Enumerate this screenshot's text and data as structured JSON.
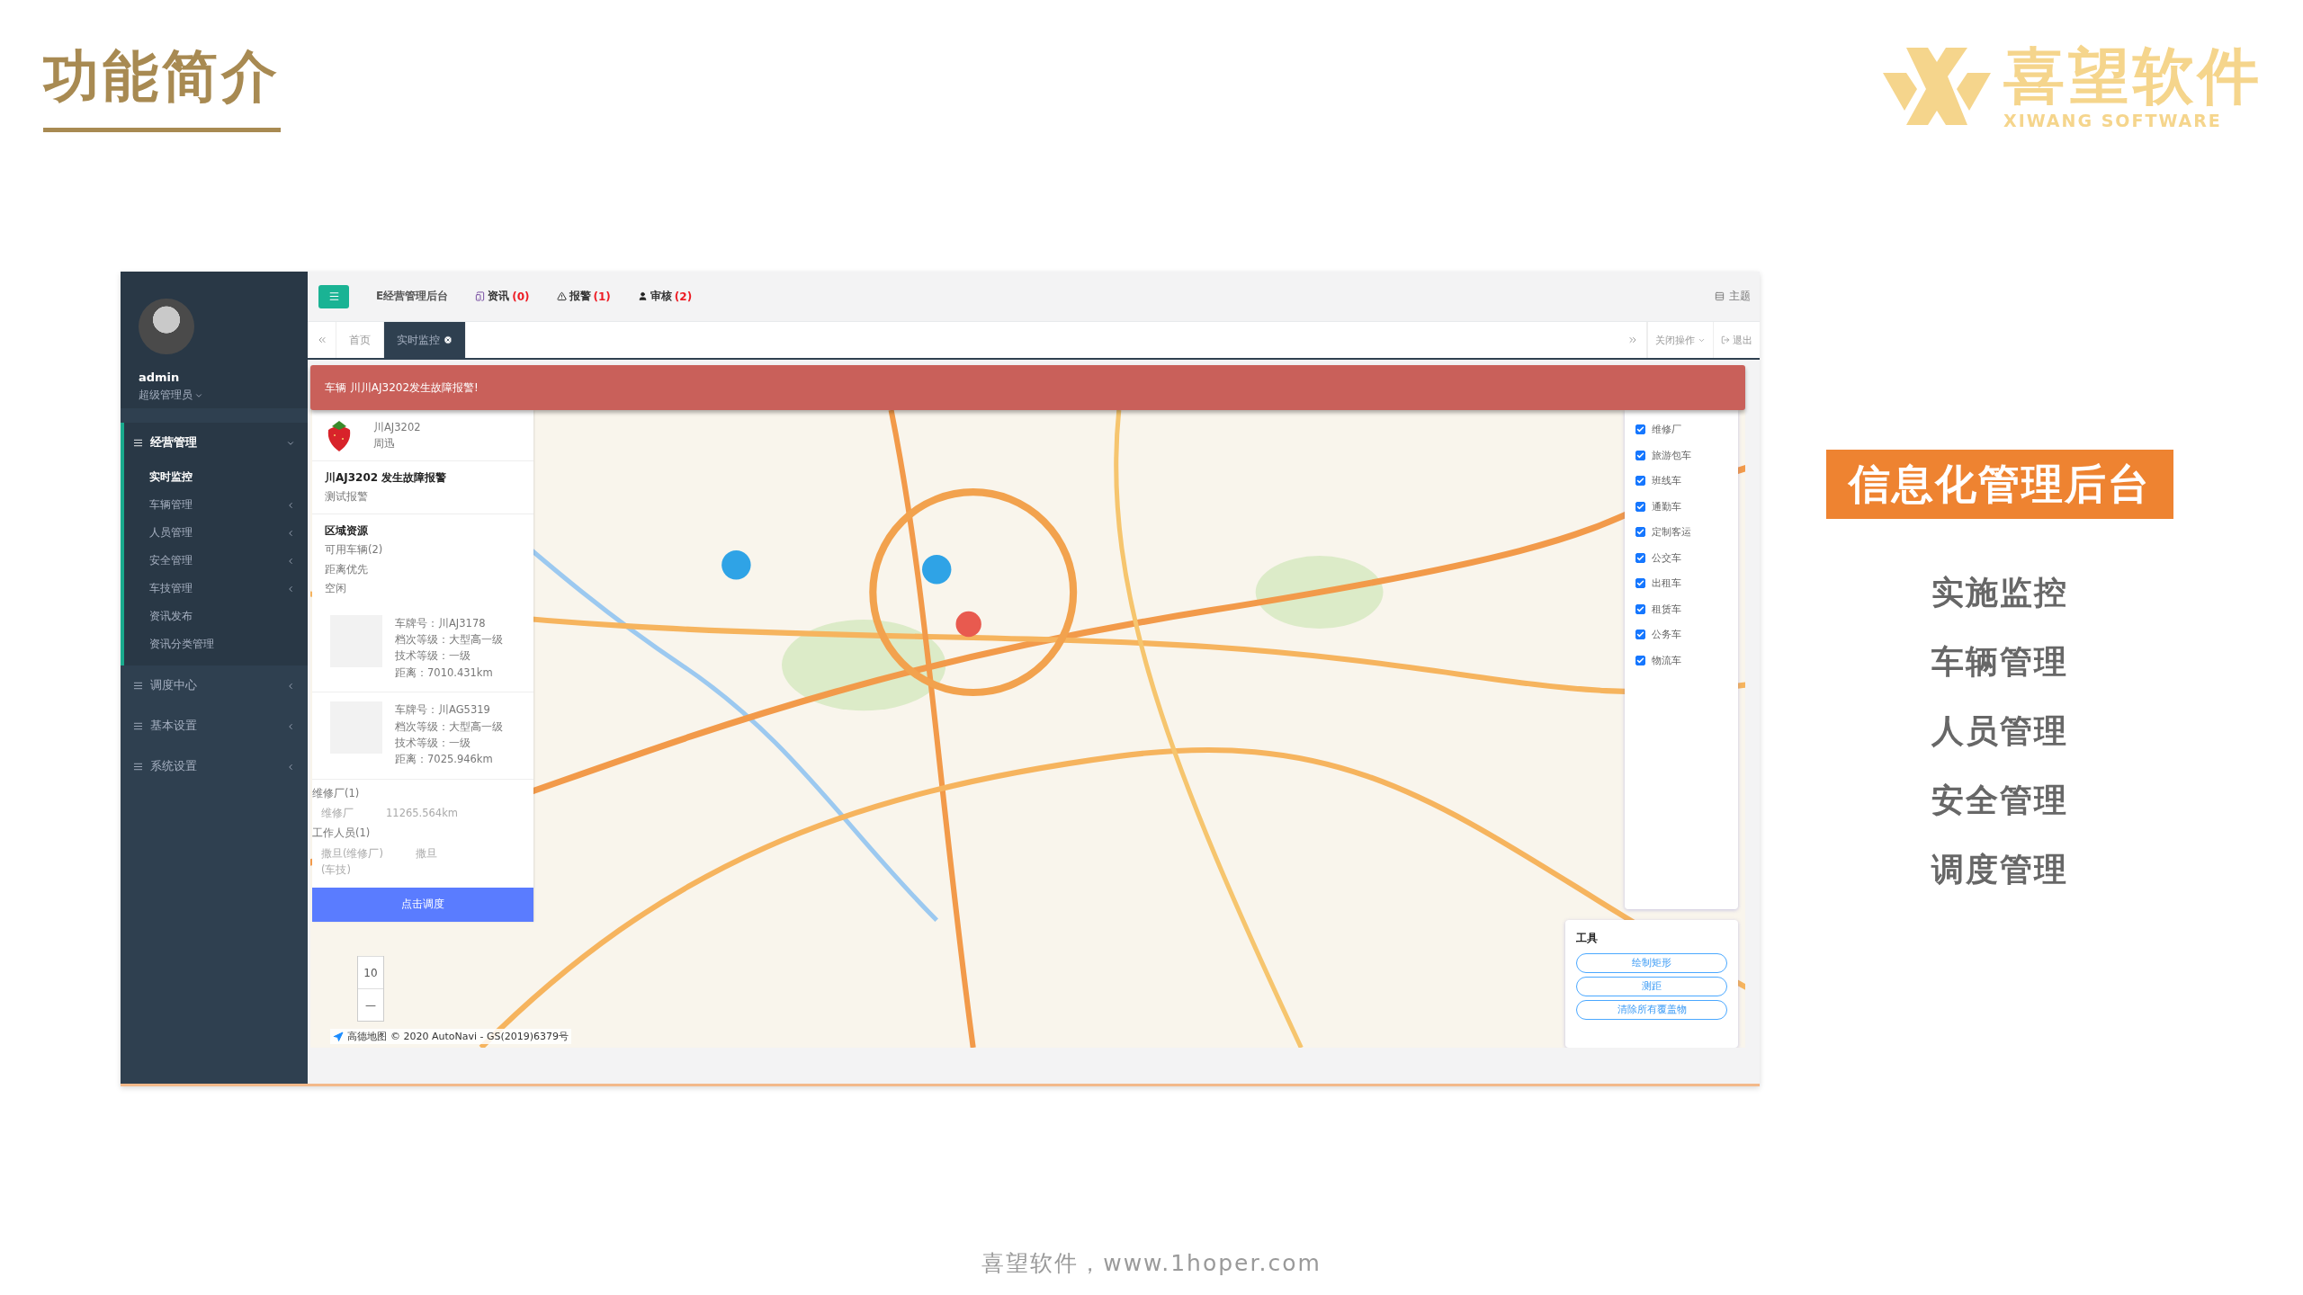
{
  "slide": {
    "title": "功能简介",
    "logo": {
      "name": "喜望软件",
      "tagline": "XIWANG SOFTWARE"
    },
    "footer": "喜望软件，www.1hoper.com"
  },
  "feature_panel": {
    "heading": "信息化管理后台",
    "items": [
      "实施监控",
      "车辆管理",
      "人员管理",
      "安全管理",
      "调度管理"
    ]
  },
  "app": {
    "user": {
      "name": "admin",
      "role": "超级管理员"
    },
    "menu": [
      {
        "label": "经营管理",
        "expanded": true,
        "children": [
          {
            "label": "实时监控",
            "selected": true,
            "has_submenu": false
          },
          {
            "label": "车辆管理",
            "selected": false,
            "has_submenu": true
          },
          {
            "label": "人员管理",
            "selected": false,
            "has_submenu": true
          },
          {
            "label": "安全管理",
            "selected": false,
            "has_submenu": true
          },
          {
            "label": "车技管理",
            "selected": false,
            "has_submenu": true
          },
          {
            "label": "资讯发布",
            "selected": false,
            "has_submenu": false
          },
          {
            "label": "资讯分类管理",
            "selected": false,
            "has_submenu": false
          }
        ]
      },
      {
        "label": "调度中心",
        "expanded": false
      },
      {
        "label": "基本设置",
        "expanded": false
      },
      {
        "label": "系统设置",
        "expanded": false
      }
    ],
    "topbar": {
      "title": "E经营管理后台",
      "links": [
        {
          "kind": "info",
          "label": "资讯",
          "count": "(0)"
        },
        {
          "kind": "alarm",
          "label": "报警",
          "count": "(1)"
        },
        {
          "kind": "review",
          "label": "审核",
          "count": "(2)"
        }
      ],
      "theme": "主题"
    },
    "tabs": [
      {
        "label": "首页",
        "selected": false,
        "closable": false
      },
      {
        "label": "实时监控",
        "selected": true,
        "closable": true
      }
    ],
    "tab_actions": {
      "close_ops": "关闭操作",
      "logout": "退出"
    },
    "alert": "车辆 川川AJ3202发生故障报警!",
    "vehicle": {
      "plate": "川AJ3202",
      "driver": "周迅"
    },
    "event": {
      "title": "川AJ3202 发生故障报警",
      "desc": "测试报警"
    },
    "resources": {
      "title": "区域资源",
      "lines": [
        "可用车辆(2)",
        "距离优先",
        "空闲"
      ],
      "vehicles": [
        {
          "plate": "车牌号：川AJ3178",
          "grade": "档次等级：大型高一级",
          "tech": "技术等级：一级",
          "distance": "距离：7010.431km"
        },
        {
          "plate": "车牌号：川AG5319",
          "grade": "档次等级：大型高一级",
          "tech": "技术等级：一级",
          "distance": "距离：7025.946km"
        }
      ],
      "repair_header": "维修厂(1)",
      "repair": {
        "name": "维修厂",
        "distance": "11265.564km"
      },
      "staff_header": "工作人员(1)",
      "staff": {
        "name_lines": [
          "撒旦(维修厂)",
          "(车技)"
        ],
        "value": "撒旦"
      }
    },
    "dispatch_button": "点击调度",
    "zoom": {
      "level": "10",
      "out": "—"
    },
    "attribution": {
      "brand": "高德地图",
      "text": "© 2020 AutoNavi - GS(2019)6379号"
    },
    "layers": [
      {
        "label": "维修厂",
        "checked": true
      },
      {
        "label": "旅游包车",
        "checked": true
      },
      {
        "label": "班线车",
        "checked": true
      },
      {
        "label": "通勤车",
        "checked": true
      },
      {
        "label": "定制客运",
        "checked": true
      },
      {
        "label": "公交车",
        "checked": true
      },
      {
        "label": "出租车",
        "checked": true
      },
      {
        "label": "租赁车",
        "checked": true
      },
      {
        "label": "公务车",
        "checked": true
      },
      {
        "label": "物流车",
        "checked": true
      }
    ],
    "tools": {
      "title": "工具",
      "buttons": [
        "绘制矩形",
        "测距",
        "清除所有覆盖物"
      ]
    }
  }
}
